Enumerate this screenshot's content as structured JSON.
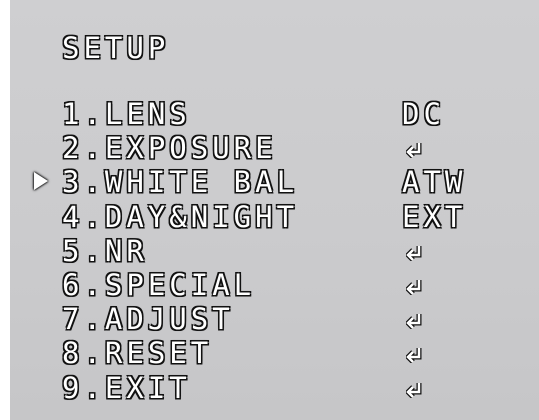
{
  "title": "SETUP",
  "cursor_icon": "triangle-right-icon",
  "menu": {
    "items": [
      {
        "label": "1.LENS",
        "value": "DC",
        "value_icon": null
      },
      {
        "label": "2.EXPOSURE",
        "value": null,
        "value_icon": "enter-arrow-icon"
      },
      {
        "label": "3.WHITE BAL",
        "value": "ATW",
        "value_icon": null,
        "selected": true
      },
      {
        "label": "4.DAY&NIGHT",
        "value": "EXT",
        "value_icon": null
      },
      {
        "label": "5.NR",
        "value": null,
        "value_icon": "enter-arrow-icon"
      },
      {
        "label": "6.SPECIAL",
        "value": null,
        "value_icon": "enter-arrow-icon"
      },
      {
        "label": "7.ADJUST",
        "value": null,
        "value_icon": "enter-arrow-icon"
      },
      {
        "label": "8.RESET",
        "value": null,
        "value_icon": "enter-arrow-icon"
      },
      {
        "label": "9.EXIT",
        "value": null,
        "value_icon": "enter-arrow-icon"
      }
    ]
  },
  "colors": {
    "text": "#ffffff",
    "outline": "#111111",
    "background": "#cbcbcd"
  }
}
